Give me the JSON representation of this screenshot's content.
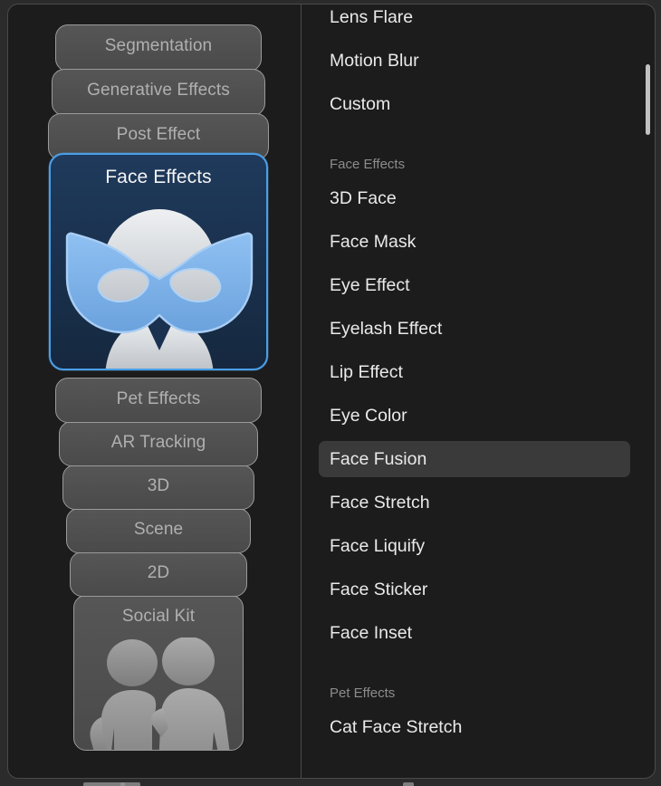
{
  "window": {
    "background_color": "#1c1c1c",
    "border_color": "#4a4a4a"
  },
  "sidebar": {
    "name": "effect-category-card-stack",
    "cards": [
      {
        "label": "Segmentation",
        "selected": false,
        "art": "none"
      },
      {
        "label": "Generative Effects",
        "selected": false,
        "art": "none"
      },
      {
        "label": "Post Effect",
        "selected": false,
        "art": "none"
      },
      {
        "label": "Face Effects",
        "selected": true,
        "art": "face-mask-art"
      },
      {
        "label": "Pet Effects",
        "selected": false,
        "art": "none"
      },
      {
        "label": "AR Tracking",
        "selected": false,
        "art": "none"
      },
      {
        "label": "3D",
        "selected": false,
        "art": "none"
      },
      {
        "label": "Scene",
        "selected": false,
        "art": "none"
      },
      {
        "label": "2D",
        "selected": false,
        "art": "none"
      },
      {
        "label": "Social Kit",
        "selected": false,
        "art": "two-people-art"
      }
    ],
    "selected_label": "Face Effects",
    "accent_color": "#4a9fe8",
    "selected_card_bg": "#1b3150",
    "card_bg": "#4d4d4d",
    "card_border": "#9a9a9a",
    "card_text": "#b0b0b0"
  },
  "menu": {
    "name": "effects-menu",
    "highlighted_item": "Face Fusion",
    "highlight_color": "#3a3a3a",
    "header_color": "#8c8c8c",
    "item_color": "#eaeaea",
    "groups": [
      {
        "header": null,
        "items": [
          "Lens Flare",
          "Motion Blur",
          "Custom"
        ]
      },
      {
        "header": "Face Effects",
        "items": [
          "3D Face",
          "Face Mask",
          "Eye Effect",
          "Eyelash Effect",
          "Lip Effect",
          "Eye Color",
          "Face Fusion",
          "Face Stretch",
          "Face Liquify",
          "Face Sticker",
          "Face Inset"
        ]
      },
      {
        "header": "Pet Effects",
        "items": [
          "Cat Face Stretch"
        ]
      }
    ],
    "scrollbar": {
      "visible": true
    }
  }
}
